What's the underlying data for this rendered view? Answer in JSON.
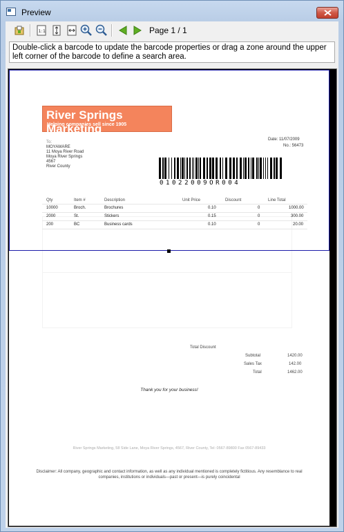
{
  "window": {
    "title": "Preview"
  },
  "toolbar": {
    "icons": [
      "save-icon",
      "actual-size-icon",
      "fit-page-icon",
      "fit-width-icon",
      "zoom-in-icon",
      "zoom-out-icon",
      "previous-page-icon",
      "next-page-icon"
    ],
    "page_label": "Page 1 / 1",
    "accent_green": "#5fae23"
  },
  "hint": {
    "text": "Double-click a barcode to update the barcode properties or drag a zone around the upper left corner of the barcode to define a search area."
  },
  "document": {
    "logo_title": "River Springs Marketing",
    "logo_subtitle": "Helping companies sell since 1905",
    "logo_color": "#f4845c",
    "to_label": "To:",
    "address": [
      "MOYAWARE",
      "11 Moya River Road",
      "Moya River Springs",
      "4567",
      "River County"
    ],
    "date": "Date: 11/07/2009",
    "number": "No.: 56473",
    "barcode_value": "0102200​9OR004",
    "barcode_text": "0102200​9OR004",
    "table_headers": [
      "Qty",
      "Item #",
      "Description",
      "Unit Price",
      "Discount",
      "Line Total"
    ],
    "rows": [
      [
        "10000",
        "Broch.",
        "Brochures",
        "0.10",
        "0",
        "1000.00"
      ],
      [
        "2000",
        "St.",
        "Stickers",
        "0.15",
        "0",
        "300.00"
      ],
      [
        "200",
        "BC",
        "Business cards",
        "0.10",
        "0",
        "20.00"
      ]
    ],
    "total_discount_label": "Total Discount",
    "subtotal_label": "Subtotal",
    "subtotal_value": "1420.00",
    "sales_tax_label": "Sales Tax",
    "sales_tax_value": "142.00",
    "total_label": "Total",
    "total_value": "1462.00",
    "thanks": "Thank you for your business!",
    "footer": "River Springs Marketing, 58 Side Lane, Moya River Springs, 4567, River County, Tel: 0567-89800 Fax 0567-89433",
    "disclaimer": "Disclaimer: All company, geographic and contact information, as well as any individual mentioned is completely fictitious. Any resemblance to real companies, institutions or individuals—past or present—is purely coincidental"
  }
}
